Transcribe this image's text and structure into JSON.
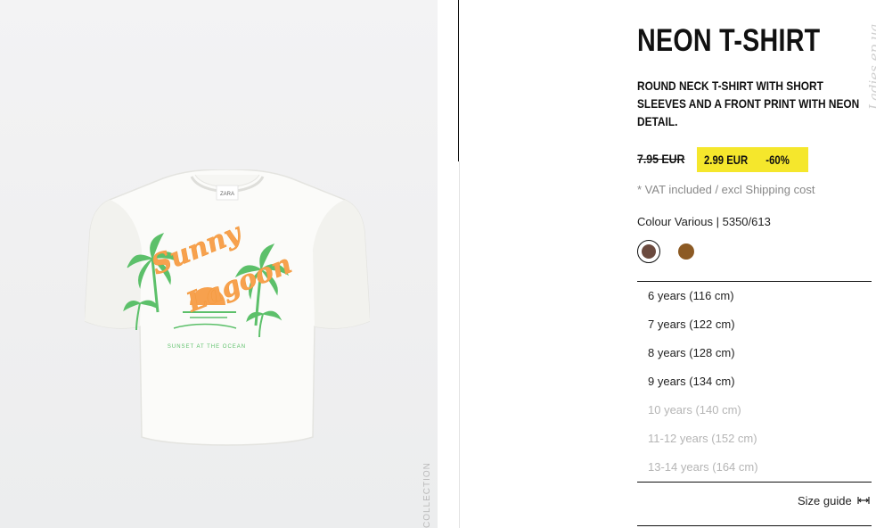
{
  "product": {
    "title": "NEON T-SHIRT",
    "description": "ROUND NECK T-SHIRT WITH SHORT SLEEVES AND A FRONT PRINT WITH NEON DETAIL.",
    "old_price": "7.95 EUR",
    "sale_price": "2.99 EUR",
    "discount": "-60%",
    "vat_note": "* VAT included / excl Shipping cost",
    "colour_line": "Colour Various | 5350/613",
    "image_label": "COLLECTION",
    "print_text_1": "Sunny",
    "print_text_2": "Lagoon",
    "print_subtext": "SUNSET AT THE OCEAN"
  },
  "watermark": "Ladies.ep.ua",
  "colors": {
    "swatches": [
      "#6b4a3e",
      "#8c5a24"
    ],
    "badge": "#f5e72c",
    "print_orange": "#f7a14e",
    "print_green": "#5cc06a"
  },
  "sizes": [
    {
      "label": "6 years (116 cm)",
      "available": true
    },
    {
      "label": "7 years (122 cm)",
      "available": true
    },
    {
      "label": "8 years (128 cm)",
      "available": true
    },
    {
      "label": "9 years (134 cm)",
      "available": true
    },
    {
      "label": "10 years (140 cm)",
      "available": false
    },
    {
      "label": "11-12 years (152 cm)",
      "available": false
    },
    {
      "label": "13-14 years (164 cm)",
      "available": false
    }
  ],
  "size_guide": {
    "label": "Size guide",
    "icon": "arrows-horizontal-icon"
  }
}
